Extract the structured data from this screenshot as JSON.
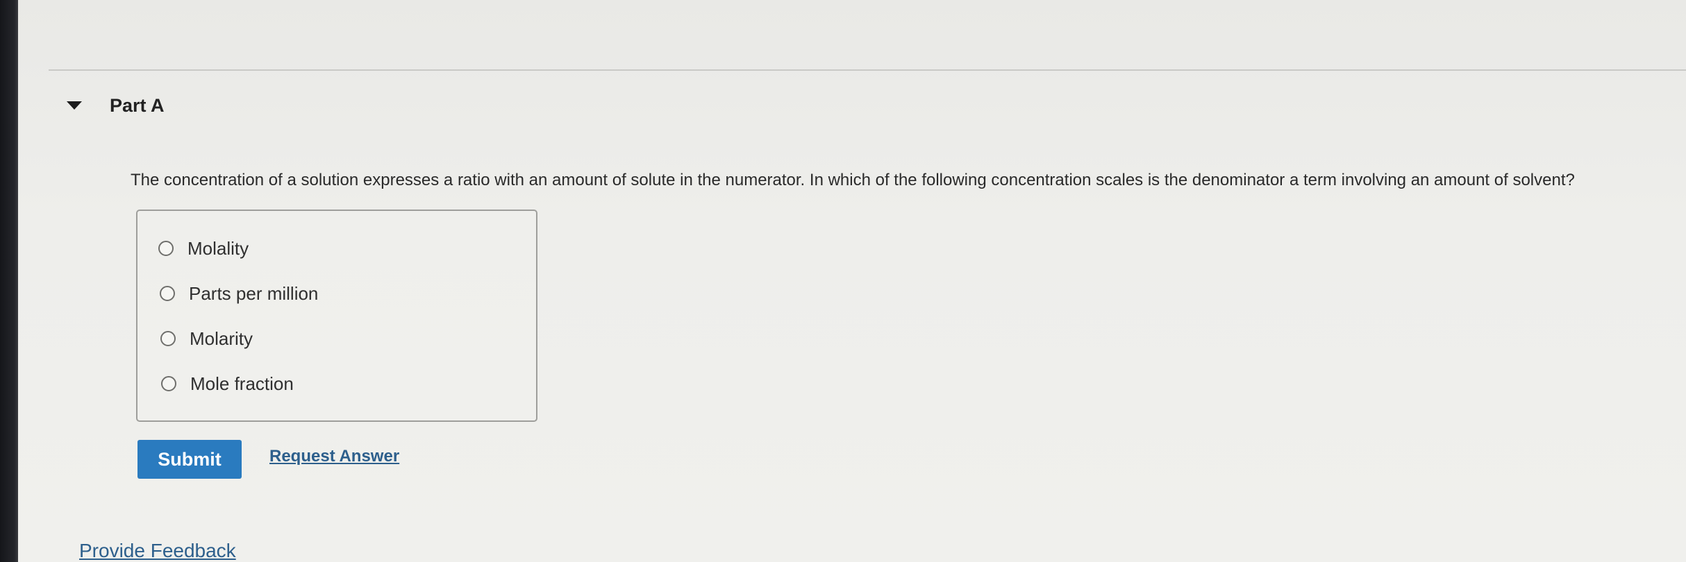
{
  "part": {
    "title": "Part A",
    "caret_icon": "caret-down-icon"
  },
  "question": {
    "text": "The concentration of a solution expresses a ratio with an amount of solute in the numerator. In which of the following concentration scales is the denominator a term involving an amount of solvent?"
  },
  "options": [
    {
      "label": "Molality",
      "selected": false
    },
    {
      "label": "Parts per million",
      "selected": false
    },
    {
      "label": "Molarity",
      "selected": false
    },
    {
      "label": "Mole fraction",
      "selected": false
    }
  ],
  "actions": {
    "submit_label": "Submit",
    "request_answer_label": "Request Answer"
  },
  "footer": {
    "feedback_label": "Provide Feedback"
  },
  "colors": {
    "submit_bg": "#2a7bbf",
    "link": "#2d5f8c"
  }
}
